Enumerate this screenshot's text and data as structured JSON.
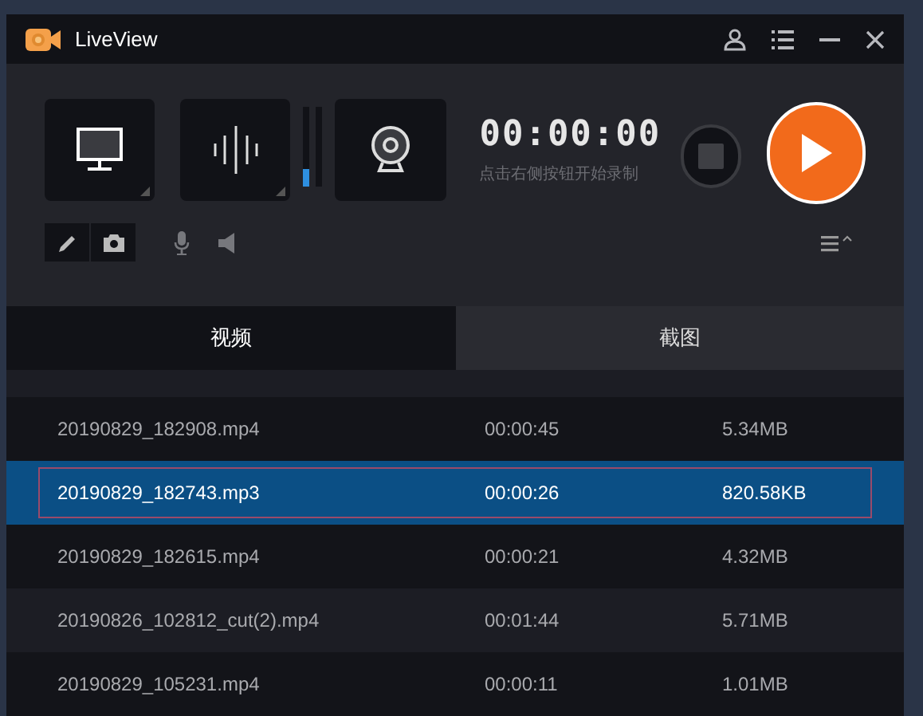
{
  "window": {
    "title": "LiveView"
  },
  "recorder": {
    "audio_level": {
      "level": 0.22
    },
    "timer": "00:00:00",
    "hint": "点击右侧按钮开始录制"
  },
  "tabs": [
    {
      "label": "视频",
      "selected": true
    },
    {
      "label": "截图",
      "selected": false
    }
  ],
  "files": [
    {
      "name": "20190829_182908.mp4",
      "duration": "00:00:45",
      "size": "5.34MB",
      "selected": false
    },
    {
      "name": "20190829_182743.mp3",
      "duration": "00:00:26",
      "size": "820.58KB",
      "selected": true
    },
    {
      "name": "20190829_182615.mp4",
      "duration": "00:00:21",
      "size": "4.32MB",
      "selected": false
    },
    {
      "name": "20190826_102812_cut(2).mp4",
      "duration": "00:01:44",
      "size": "5.71MB",
      "selected": false
    },
    {
      "name": "20190829_105231.mp4",
      "duration": "00:00:11",
      "size": "1.01MB",
      "selected": false
    }
  ]
}
